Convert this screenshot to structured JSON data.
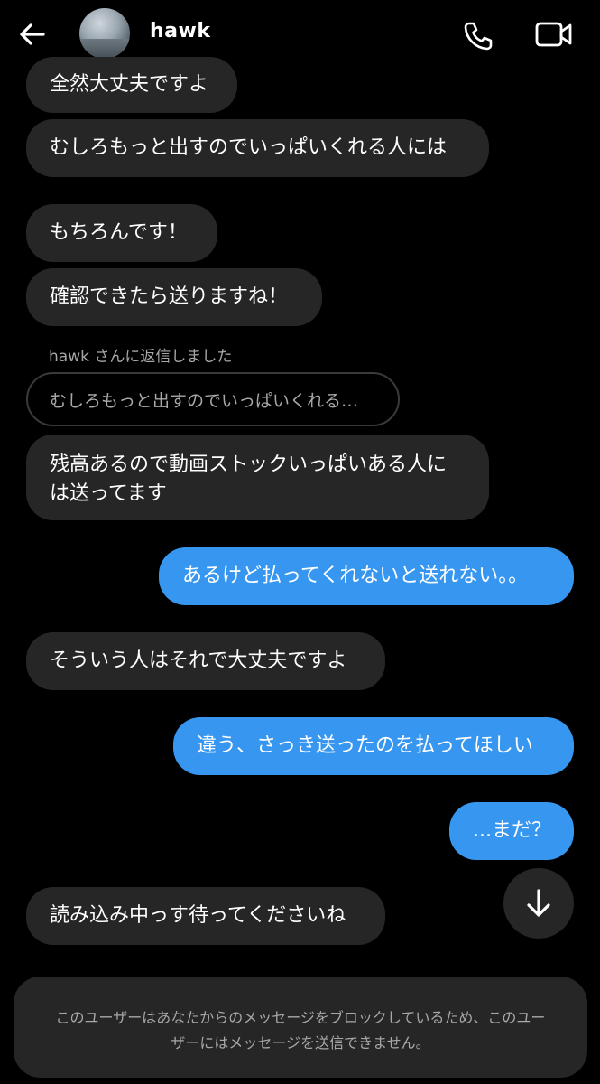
{
  "header": {
    "username": "hawk",
    "back_icon": "arrow-left-icon",
    "call_icon": "phone-icon",
    "video_icon": "video-camera-icon"
  },
  "messages": [
    {
      "side": "in",
      "text": "全然大丈夫ですよ"
    },
    {
      "side": "in",
      "text": "むしろもっと出すのでいっぱいくれる人には"
    },
    {
      "side": "in",
      "text": "もちろんです！"
    },
    {
      "side": "in",
      "text": "確認できたら送りますね！"
    },
    {
      "side": "in",
      "text": "残高あるので動画ストックいっぱいある人には送ってます",
      "reply_label": "hawk さんに返信しました",
      "reply_quote": "むしろもっと出すのでいっぱいくれる…"
    },
    {
      "side": "out",
      "text": "あるけど払ってくれないと送れない。。"
    },
    {
      "side": "in",
      "text": "そういう人はそれで大丈夫ですよ"
    },
    {
      "side": "out",
      "text": "違う、さっき送ったのを払ってほしい"
    },
    {
      "side": "out",
      "text": "...まだ？"
    },
    {
      "side": "in",
      "text": "読み込み中っす待ってくださいね"
    }
  ],
  "scroll_button_icon": "arrow-down-icon",
  "blocked_notice": "このユーザーはあなたからのメッセージをブロックしているため、このユーザーにはメッセージを送信できません。",
  "colors": {
    "background": "#000000",
    "incoming_bubble": "#262626",
    "outgoing_bubble": "#3797f0",
    "muted_text": "#a8a8a8"
  }
}
